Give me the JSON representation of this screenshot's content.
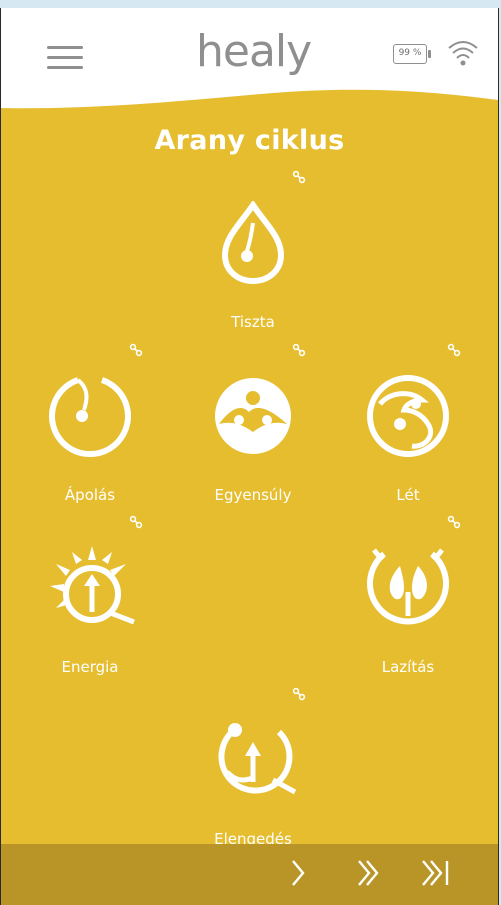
{
  "header": {
    "logo_text": "healy",
    "battery_label": "99 %",
    "icons": [
      "menu-icon",
      "battery-icon",
      "wifi-icon"
    ]
  },
  "page": {
    "title": "Arany ciklus"
  },
  "programs": [
    {
      "label": "Tiszta",
      "icon": "drop-icon"
    },
    {
      "label": "Ápolás",
      "icon": "ring-drop-icon"
    },
    {
      "label": "Egyensúly",
      "icon": "balance-icon"
    },
    {
      "label": "Lét",
      "icon": "swirl-icon"
    },
    {
      "label": "Energia",
      "icon": "sun-arrow-icon"
    },
    {
      "label": "Lazítás",
      "icon": "two-drops-icon"
    },
    {
      "label": "Elengedés",
      "icon": "release-arrow-icon"
    }
  ],
  "footer": {
    "icons": [
      "next-icon",
      "fast-forward-icon",
      "skip-to-end-icon"
    ]
  },
  "colors": {
    "background": "#e5bd2f",
    "footer": "#b99527",
    "header": "#ffffff",
    "icon_gray": "#8f8f8f",
    "text": "#ffffff"
  }
}
